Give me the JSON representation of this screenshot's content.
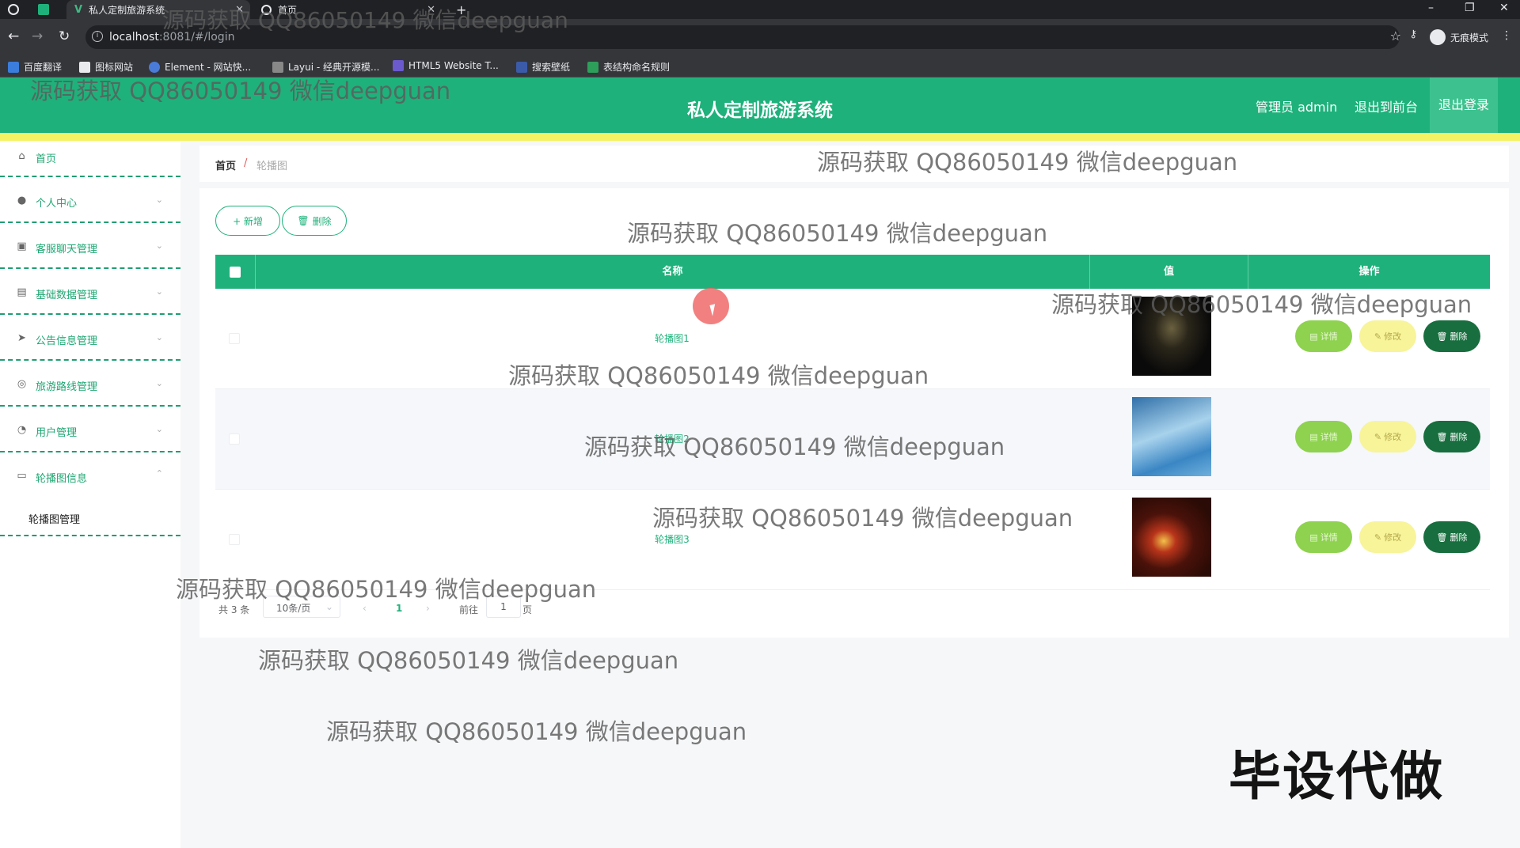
{
  "browser": {
    "tabs": [
      {
        "title": "私人定制旅游系统",
        "active": true
      },
      {
        "title": "首页",
        "active": false
      }
    ],
    "new_tab": "+",
    "url_host": "localhost",
    "url_rest": ":8081/#/login",
    "incognito_label": "无痕模式",
    "bookmarks": [
      "百度翻译",
      "图标网站",
      "Element - 网站快...",
      "Layui - 经典开源模...",
      "HTML5 Website T...",
      "搜索壁纸",
      "表结构命名规则"
    ]
  },
  "header": {
    "title": "私人定制旅游系统",
    "admin_label": "管理员 admin",
    "to_front_label": "退出到前台",
    "logout_label": "退出登录"
  },
  "sidebar": {
    "items": [
      {
        "label": "首页",
        "icon": "home-icon",
        "chevron": false
      },
      {
        "label": "个人中心",
        "icon": "user-icon",
        "chevron": true
      },
      {
        "label": "客服聊天管理",
        "icon": "chat-icon",
        "chevron": true
      },
      {
        "label": "基础数据管理",
        "icon": "database-icon",
        "chevron": true
      },
      {
        "label": "公告信息管理",
        "icon": "send-icon",
        "chevron": true
      },
      {
        "label": "旅游路线管理",
        "icon": "route-icon",
        "chevron": true
      },
      {
        "label": "用户管理",
        "icon": "users-icon",
        "chevron": true
      },
      {
        "label": "轮播图信息",
        "icon": "message-icon",
        "chevron": true
      }
    ],
    "submenu_label": "轮播图管理"
  },
  "breadcrumb": {
    "home": "首页",
    "separator": "/",
    "current": "轮播图"
  },
  "toolbar": {
    "add_label": "+ 新增",
    "delete_label": "删除"
  },
  "table": {
    "columns": [
      "名称",
      "值",
      "操作"
    ],
    "rows": [
      {
        "name": "轮播图1",
        "thumb_colors": [
          "#0a0a0a",
          "#6b6140",
          "#1c1a14"
        ]
      },
      {
        "name": "轮播图2",
        "thumb_colors": [
          "#3a86c4",
          "#a8d2ec",
          "#2f6fa8"
        ]
      },
      {
        "name": "轮播图3",
        "thumb_colors": [
          "#2a0b05",
          "#b8341a",
          "#f2c04a"
        ]
      }
    ],
    "action_labels": {
      "detail": "详情",
      "edit": "修改",
      "delete": "删除"
    }
  },
  "pagination": {
    "total_label": "共 3 条",
    "page_size": "10条/页",
    "current_page": "1",
    "goto_prefix": "前往",
    "goto_value": "1",
    "goto_suffix": "页"
  },
  "overlay": {
    "watermark": "源码获取 QQ86050149 微信deepguan",
    "ad_text": "毕设代做"
  },
  "colors": {
    "primary": "#1fb17b",
    "stripe": "#f5f263",
    "detail_btn": "#8ed24f",
    "edit_btn": "#f7f49a",
    "delete_btn": "#186e3e"
  }
}
